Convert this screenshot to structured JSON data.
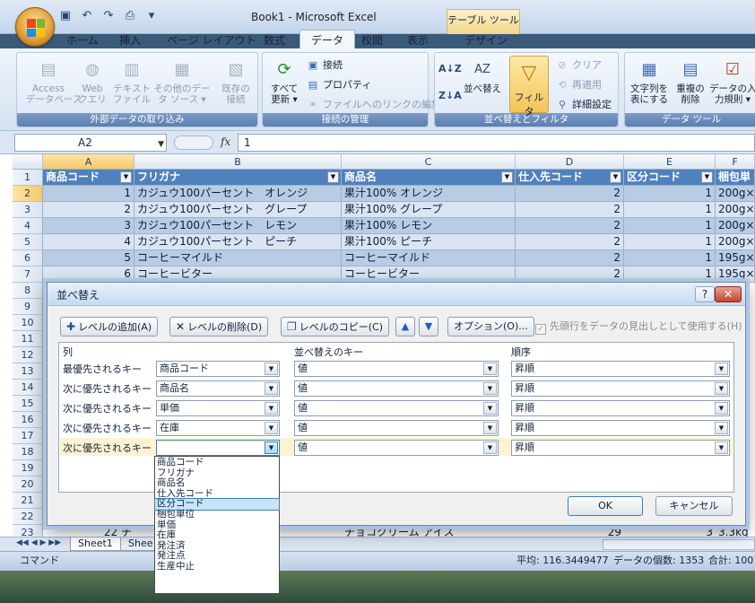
{
  "window": {
    "title": "Book1 - Microsoft Excel",
    "context_tab_header": "テーブル ツール"
  },
  "ribbon_tabs": [
    "ホーム",
    "挿入",
    "ページ レイアウト",
    "数式",
    "データ",
    "校閲",
    "表示",
    "デザイン"
  ],
  "ribbon": {
    "groups": {
      "external": "外部データの取り込み",
      "connections": "接続の管理",
      "sort_filter": "並べ替えとフィルタ",
      "tools": "データ ツール"
    },
    "buttons": {
      "access": "Access\nデータベース",
      "web": "Web\nクエリ",
      "text": "テキスト\nファイル",
      "other": "その他のデー\nタ ソース ▾",
      "existing": "既存の\n接続",
      "refresh_all": "すべて\n更新 ▾",
      "connections": "接続",
      "properties": "プロパティ",
      "edit_links": "ファイルへのリンクの編集",
      "sort": "並べ替え",
      "filter": "フィルタ",
      "clear": "クリア",
      "reapply": "再適用",
      "advanced": "詳細設定",
      "text_to_cols": "文字列を\n表にする",
      "remove_dup": "重複の\n削除",
      "validation": "データの入\n力規則 ▾"
    }
  },
  "formula_bar": {
    "name_box": "A2",
    "fx": "fx",
    "value": "1"
  },
  "columns": [
    "A",
    "B",
    "C",
    "D",
    "E",
    "F"
  ],
  "table": {
    "headers": [
      "商品コード",
      "フリガナ",
      "商品名",
      "仕入先コード",
      "区分コード",
      "梱包単"
    ],
    "rows": [
      [
        "1",
        "カジュウ100パーセント　オレンジ",
        "果汁100% オレンジ",
        "2",
        "1",
        "200g×"
      ],
      [
        "2",
        "カジュウ100パーセント　グレープ",
        "果汁100% グレープ",
        "2",
        "1",
        "200g×"
      ],
      [
        "3",
        "カジュウ100パーセント　レモン",
        "果汁100% レモン",
        "2",
        "1",
        "200g×"
      ],
      [
        "4",
        "カジュウ100パーセント　ピーチ",
        "果汁100% ピーチ",
        "2",
        "1",
        "200g×"
      ],
      [
        "5",
        "コーヒーマイルド",
        "コーヒーマイルド",
        "2",
        "1",
        "195g×"
      ],
      [
        "6",
        "コーヒービター",
        "コーヒービター",
        "2",
        "1",
        "195g×"
      ]
    ],
    "partial_row": {
      "a": "22 チ",
      "c": "チョコクリーム アイス",
      "d": "29",
      "e": "3",
      "f": "3.3kg"
    }
  },
  "row_numbers": [
    "1",
    "2",
    "3",
    "4",
    "5",
    "6",
    "7",
    "8",
    "9",
    "10",
    "11",
    "12",
    "13",
    "14",
    "15",
    "16",
    "17",
    "18",
    "19",
    "20",
    "21",
    "22",
    "23"
  ],
  "sheet_tabs": [
    "Sheet1",
    "Shee"
  ],
  "status": {
    "mode": "コマンド",
    "average": "平均: 116.3449477",
    "count": "データの個数: 1353",
    "sum": "合計: 1001"
  },
  "dialog": {
    "title": "並べ替え",
    "help": "?",
    "close": "✕",
    "buttons": {
      "add_level": "レベルの追加(A)",
      "delete_level": "レベルの削除(D)",
      "copy_level": "レベルのコピー(C)",
      "up": "▲",
      "down": "▼",
      "options": "オプション(O)...",
      "ok": "OK",
      "cancel": "キャンセル"
    },
    "header_checkbox": "先頭行をデータの見出しとして使用する(H)",
    "panel_headers": {
      "column": "列",
      "sort_on": "並べ替えのキー",
      "order": "順序"
    },
    "levels": [
      {
        "label": "最優先されるキー",
        "column": "商品コード",
        "sort_on": "値",
        "order": "昇順"
      },
      {
        "label": "次に優先されるキー",
        "column": "商品名",
        "sort_on": "値",
        "order": "昇順"
      },
      {
        "label": "次に優先されるキー",
        "column": "単価",
        "sort_on": "値",
        "order": "昇順"
      },
      {
        "label": "次に優先されるキー",
        "column": "在庫",
        "sort_on": "値",
        "order": "昇順"
      },
      {
        "label": "次に優先されるキー",
        "column": "",
        "sort_on": "値",
        "order": "昇順"
      }
    ],
    "dropdown_options": [
      "商品コード",
      "フリガナ",
      "商品名",
      "仕入先コード",
      "区分コード",
      "梱包単位",
      "単価",
      "在庫",
      "発注済",
      "発注点",
      "生産中止"
    ],
    "dropdown_highlight": "区分コード"
  }
}
